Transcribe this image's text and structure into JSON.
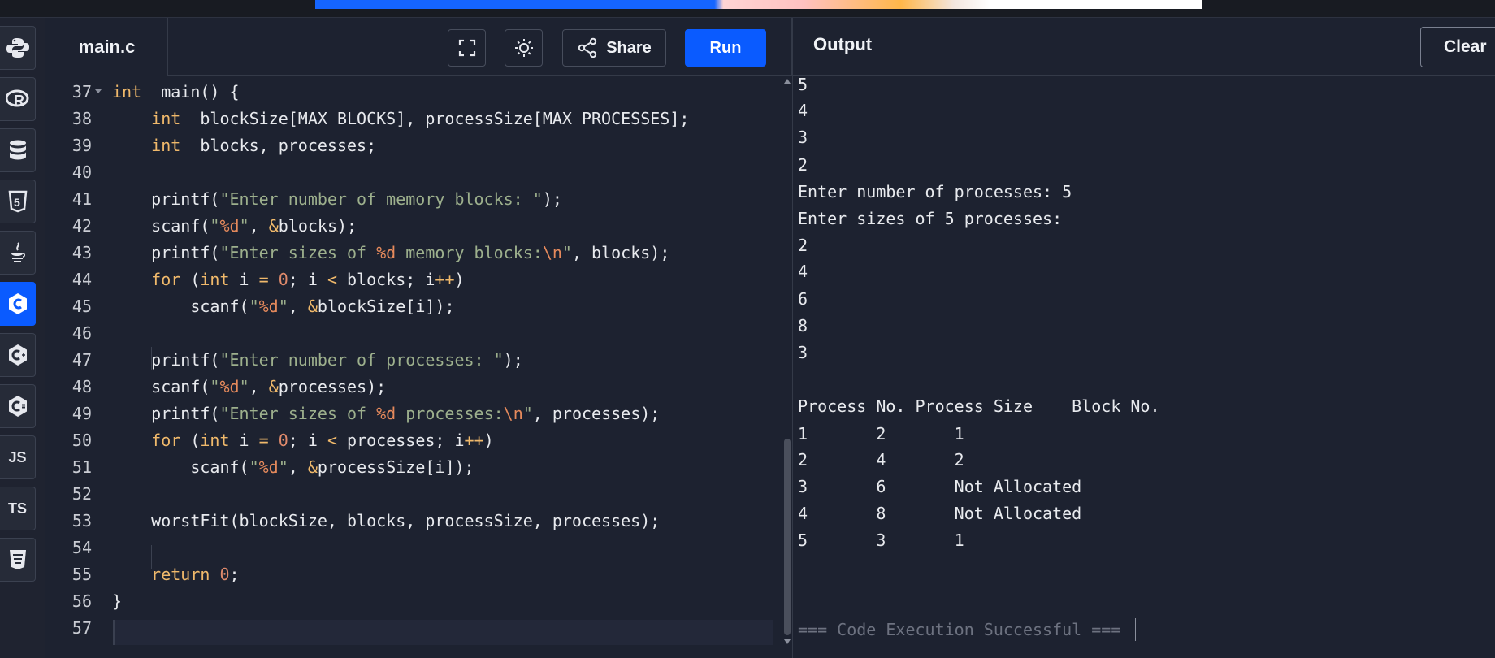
{
  "editor": {
    "tab": "main.c",
    "share_label": "Share",
    "run_label": "Run",
    "lines": [
      {
        "n": "37",
        "segs": [
          [
            "kw",
            "int"
          ],
          [
            "",
            "  main() {"
          ]
        ]
      },
      {
        "n": "38",
        "segs": [
          [
            "",
            "    "
          ],
          [
            "kw",
            "int"
          ],
          [
            "",
            "  blockSize[MAX_BLOCKS], processSize[MAX_PROCESSES];"
          ]
        ]
      },
      {
        "n": "39",
        "segs": [
          [
            "",
            "    "
          ],
          [
            "kw",
            "int"
          ],
          [
            "",
            "  blocks, processes;"
          ]
        ]
      },
      {
        "n": "40",
        "segs": []
      },
      {
        "n": "41",
        "segs": [
          [
            "",
            "    printf("
          ],
          [
            "st",
            "\"Enter number of memory blocks: \""
          ],
          [
            "",
            ");"
          ]
        ]
      },
      {
        "n": "42",
        "segs": [
          [
            "",
            "    scanf("
          ],
          [
            "st",
            "\""
          ],
          [
            "fmt",
            "%d"
          ],
          [
            "st",
            "\""
          ],
          [
            "",
            ", "
          ],
          [
            "kw",
            "&"
          ],
          [
            "",
            "blocks);"
          ]
        ]
      },
      {
        "n": "43",
        "segs": [
          [
            "",
            "    printf("
          ],
          [
            "st",
            "\"Enter sizes of "
          ],
          [
            "fmt",
            "%d"
          ],
          [
            "st",
            " memory blocks:"
          ],
          [
            "fmt",
            "\\n"
          ],
          [
            "st",
            "\""
          ],
          [
            "",
            ", blocks);"
          ]
        ]
      },
      {
        "n": "44",
        "segs": [
          [
            "",
            "    "
          ],
          [
            "kw",
            "for"
          ],
          [
            "",
            " ("
          ],
          [
            "kw",
            "int"
          ],
          [
            "",
            " i "
          ],
          [
            "kw",
            "="
          ],
          [
            "",
            ""
          ],
          [
            "num",
            " 0"
          ],
          [
            "",
            "; i "
          ],
          [
            "kw",
            "<"
          ],
          [
            "",
            ""
          ],
          [
            "",
            " blocks; i"
          ],
          [
            "kw",
            "++"
          ],
          [
            "",
            ")"
          ]
        ]
      },
      {
        "n": "45",
        "segs": [
          [
            "",
            "        scanf("
          ],
          [
            "st",
            "\""
          ],
          [
            "fmt",
            "%d"
          ],
          [
            "st",
            "\""
          ],
          [
            "",
            ", "
          ],
          [
            "kw",
            "&"
          ],
          [
            "",
            "blockSize[i]);"
          ]
        ]
      },
      {
        "n": "46",
        "segs": []
      },
      {
        "n": "47",
        "segs": [
          [
            "",
            "    printf("
          ],
          [
            "st",
            "\"Enter number of processes: \""
          ],
          [
            "",
            ");"
          ]
        ]
      },
      {
        "n": "48",
        "segs": [
          [
            "",
            "    scanf("
          ],
          [
            "st",
            "\""
          ],
          [
            "fmt",
            "%d"
          ],
          [
            "st",
            "\""
          ],
          [
            "",
            ", "
          ],
          [
            "kw",
            "&"
          ],
          [
            "",
            "processes);"
          ]
        ]
      },
      {
        "n": "49",
        "segs": [
          [
            "",
            "    printf("
          ],
          [
            "st",
            "\"Enter sizes of "
          ],
          [
            "fmt",
            "%d"
          ],
          [
            "st",
            " processes:"
          ],
          [
            "fmt",
            "\\n"
          ],
          [
            "st",
            "\""
          ],
          [
            "",
            ", processes);"
          ]
        ]
      },
      {
        "n": "50",
        "segs": [
          [
            "",
            "    "
          ],
          [
            "kw",
            "for"
          ],
          [
            "",
            " ("
          ],
          [
            "kw",
            "int"
          ],
          [
            "",
            " i "
          ],
          [
            "kw",
            "="
          ],
          [
            "num",
            " 0"
          ],
          [
            "",
            "; i "
          ],
          [
            "kw",
            "<"
          ],
          [
            "",
            " processes; i"
          ],
          [
            "kw",
            "++"
          ],
          [
            "",
            ")"
          ]
        ]
      },
      {
        "n": "51",
        "segs": [
          [
            "",
            "        scanf("
          ],
          [
            "st",
            "\""
          ],
          [
            "fmt",
            "%d"
          ],
          [
            "st",
            "\""
          ],
          [
            "",
            ", "
          ],
          [
            "kw",
            "&"
          ],
          [
            "",
            "processSize[i]);"
          ]
        ]
      },
      {
        "n": "52",
        "segs": []
      },
      {
        "n": "53",
        "segs": [
          [
            "",
            "    worstFit(blockSize, blocks, processSize, processes);"
          ]
        ]
      },
      {
        "n": "54",
        "segs": []
      },
      {
        "n": "55",
        "segs": [
          [
            "",
            "    "
          ],
          [
            "kw",
            "return"
          ],
          [
            "num",
            " 0"
          ],
          [
            "",
            ";"
          ]
        ]
      },
      {
        "n": "56",
        "segs": [
          [
            "",
            "}"
          ]
        ]
      },
      {
        "n": "57",
        "segs": []
      }
    ]
  },
  "output": {
    "title": "Output",
    "clear_label": "Clear",
    "lines": [
      "5",
      "4",
      "3",
      "2",
      "Enter number of processes: 5",
      "Enter sizes of 5 processes:",
      "2",
      "4",
      "6",
      "8",
      "3",
      "",
      "Process No. Process Size    Block No.",
      "1       2       1",
      "2       4       2",
      "3       6       Not Allocated",
      "4       8       Not Allocated",
      "5       3       1",
      "",
      "",
      ""
    ],
    "status": "=== Code Execution Successful ==="
  },
  "sidebar": {
    "languages": [
      {
        "name": "python",
        "label": ""
      },
      {
        "name": "r",
        "label": "R"
      },
      {
        "name": "sql",
        "label": ""
      },
      {
        "name": "html",
        "label": "5"
      },
      {
        "name": "java",
        "label": ""
      },
      {
        "name": "c",
        "label": "C",
        "active": true
      },
      {
        "name": "cpp",
        "label": "C"
      },
      {
        "name": "csharp",
        "label": "C"
      },
      {
        "name": "javascript",
        "label": "JS"
      },
      {
        "name": "typescript",
        "label": "TS"
      },
      {
        "name": "css",
        "label": ""
      }
    ]
  },
  "colors": {
    "accent": "#0a5bff",
    "background": "#1d2230",
    "keyword": "#f0b96b",
    "string": "#9db08d"
  }
}
